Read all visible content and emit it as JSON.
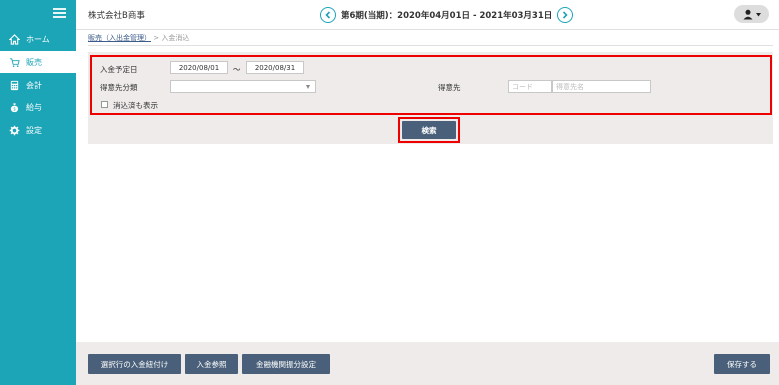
{
  "sidebar": {
    "items": [
      {
        "label": "ホーム",
        "icon": "home-icon"
      },
      {
        "label": "販売",
        "icon": "cart-icon"
      },
      {
        "label": "会計",
        "icon": "calculator-icon"
      },
      {
        "label": "給与",
        "icon": "money-bag-icon"
      },
      {
        "label": "設定",
        "icon": "gear-icon"
      }
    ],
    "active": "販売",
    "color": "#1ba5b7"
  },
  "header": {
    "company": "株式会社B商事",
    "period": "第6期(当期)：2020年04月01日 - 2021年03月31日"
  },
  "breadcrumb": {
    "parent": "販売（入出金管理）",
    "separator": ">",
    "current": "入金消込"
  },
  "search": {
    "date_label": "入金予定日",
    "date_from": "2020/08/01",
    "date_sep": "～",
    "date_to": "2020/08/31",
    "category_label": "得意先分類",
    "category_value": "",
    "customer_label": "得意先",
    "customer_code_placeholder": "コード",
    "customer_name_placeholder": "得意先名",
    "show_cleared_label": "消込済も表示",
    "show_cleared_checked": false,
    "search_button": "検索"
  },
  "footer": {
    "attach_button": "選択行の入金紐付け",
    "refer_button": "入金参照",
    "bank_button": "金融機関振分設定",
    "save_button": "保存する"
  },
  "colors": {
    "accent": "#1ba5b7",
    "button": "#4a607a",
    "highlight": "#e00000"
  }
}
